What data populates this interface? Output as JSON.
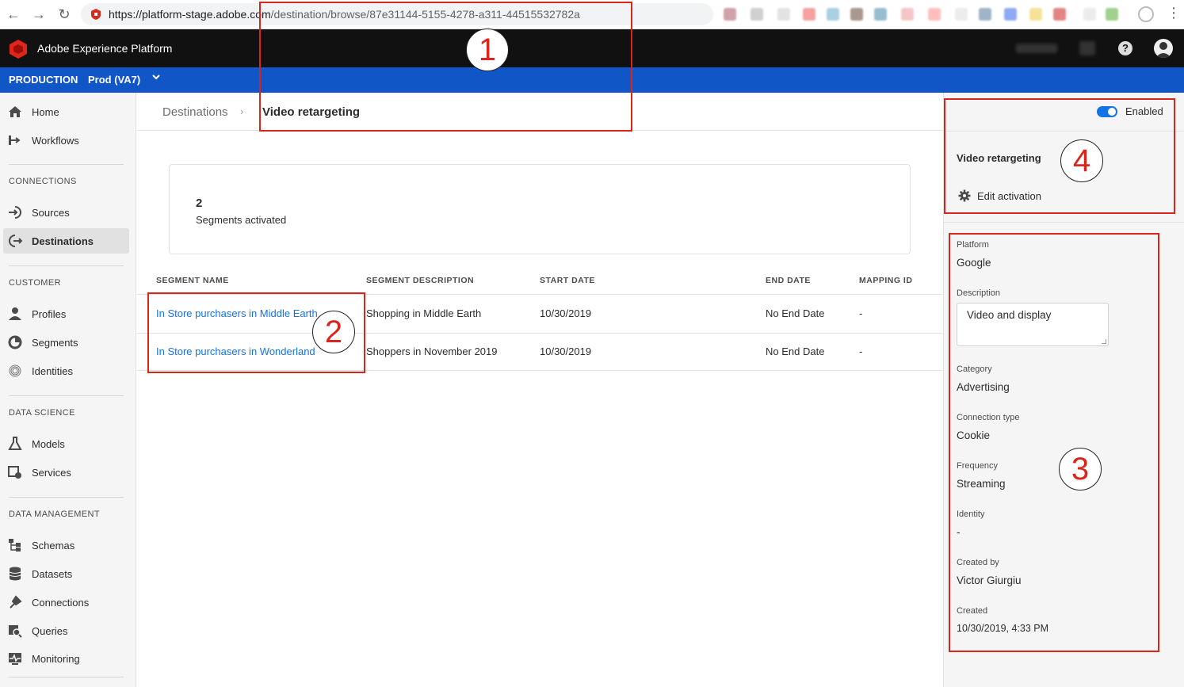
{
  "browser": {
    "url_host": "https://platform-stage.adobe.com",
    "url_path": "/destination/browse/87e31144-5155-4278-a311-44515532782a"
  },
  "app": {
    "title": "Adobe Experience Platform",
    "help_label": "?"
  },
  "org": {
    "environment": "PRODUCTION",
    "sandbox": "Prod (VA7)"
  },
  "sidebar": {
    "items": [
      {
        "label": "Home",
        "icon": "home-icon"
      },
      {
        "label": "Workflows",
        "icon": "workflows-icon"
      }
    ],
    "sections": [
      {
        "title": "CONNECTIONS",
        "items": [
          {
            "label": "Sources",
            "icon": "sources-icon"
          },
          {
            "label": "Destinations",
            "icon": "destinations-icon",
            "active": true
          }
        ]
      },
      {
        "title": "CUSTOMER",
        "items": [
          {
            "label": "Profiles",
            "icon": "profiles-icon"
          },
          {
            "label": "Segments",
            "icon": "segments-icon"
          },
          {
            "label": "Identities",
            "icon": "identities-icon"
          }
        ]
      },
      {
        "title": "DATA SCIENCE",
        "items": [
          {
            "label": "Models",
            "icon": "models-icon"
          },
          {
            "label": "Services",
            "icon": "services-icon"
          }
        ]
      },
      {
        "title": "DATA MANAGEMENT",
        "items": [
          {
            "label": "Schemas",
            "icon": "schemas-icon"
          },
          {
            "label": "Datasets",
            "icon": "datasets-icon"
          },
          {
            "label": "Connections",
            "icon": "connections-icon"
          },
          {
            "label": "Queries",
            "icon": "queries-icon"
          },
          {
            "label": "Monitoring",
            "icon": "monitoring-icon"
          }
        ]
      }
    ]
  },
  "breadcrumb": {
    "root": "Destinations",
    "separator": "›",
    "current": "Video retargeting"
  },
  "summary": {
    "count": "2",
    "label": "Segments activated"
  },
  "table": {
    "headers": [
      "SEGMENT NAME",
      "SEGMENT DESCRIPTION",
      "START DATE",
      "END DATE",
      "MAPPING ID"
    ],
    "rows": [
      [
        "In Store purchasers in Middle Earth",
        "Shopping in Middle Earth",
        "10/30/2019",
        "No End Date",
        "-"
      ],
      [
        "In Store purchasers in Wonderland",
        "Shoppers in November 2019",
        "10/30/2019",
        "No End Date",
        "-"
      ]
    ]
  },
  "panel": {
    "toggle_label": "Enabled",
    "toggle_on": true,
    "title": "Video retargeting",
    "edit_label": "Edit activation",
    "properties": [
      {
        "label": "Platform",
        "value": "Google"
      },
      {
        "label": "Description",
        "value": "Video and display"
      },
      {
        "label": "Category",
        "value": "Advertising"
      },
      {
        "label": "Connection type",
        "value": "Cookie"
      },
      {
        "label": "Frequency",
        "value": "Streaming"
      },
      {
        "label": "Identity",
        "value": "-"
      },
      {
        "label": "Created by",
        "value": "Victor Giurgiu"
      },
      {
        "label": "Created",
        "value": "10/30/2019, 4:33 PM"
      }
    ]
  },
  "annotations": [
    "1",
    "2",
    "3",
    "4"
  ],
  "colors": {
    "accent": "#1473e6",
    "org_bar": "#1156c6",
    "header": "#111111",
    "annotation": "#d9251c"
  }
}
